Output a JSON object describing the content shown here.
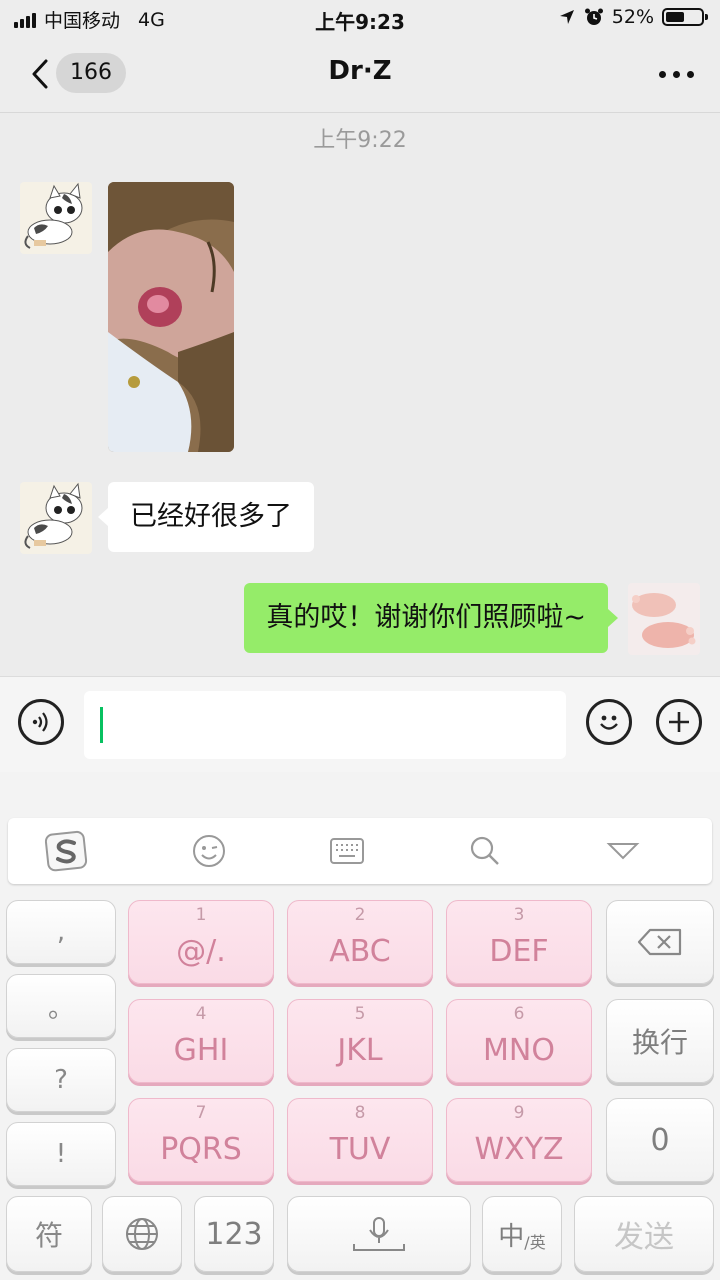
{
  "status_bar": {
    "carrier": "中国移动",
    "network": "4G",
    "time": "上午9:23",
    "battery": "52%"
  },
  "nav": {
    "unread_count": "166",
    "title": "Dr·Z"
  },
  "chat": {
    "timestamp": "上午9:22",
    "received_text": "已经好很多了",
    "sent_text": "真的哎！谢谢你们照顾啦~"
  },
  "keyboard": {
    "punct": [
      ",",
      "。",
      "?",
      "!"
    ],
    "keys": [
      {
        "num": "1",
        "label": "@/."
      },
      {
        "num": "2",
        "label": "ABC"
      },
      {
        "num": "3",
        "label": "DEF"
      },
      {
        "num": "4",
        "label": "GHI"
      },
      {
        "num": "5",
        "label": "JKL"
      },
      {
        "num": "6",
        "label": "MNO"
      },
      {
        "num": "7",
        "label": "PQRS"
      },
      {
        "num": "8",
        "label": "TUV"
      },
      {
        "num": "9",
        "label": "WXYZ"
      }
    ],
    "enter_label": "换行",
    "zero_label": "0",
    "symbol_label": "符",
    "num_label": "123",
    "lang_label_main": "中",
    "lang_label_sub": "/英",
    "send_label": "发送"
  },
  "colors": {
    "sent_bubble": "#95ec69",
    "cursor": "#07c160",
    "key_pink": "#fadbe6"
  }
}
